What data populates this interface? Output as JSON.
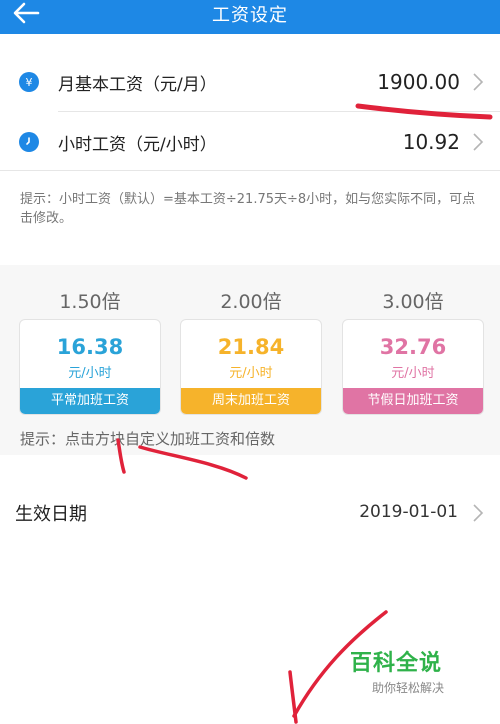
{
  "header": {
    "title": "工资设定"
  },
  "rows": {
    "monthly": {
      "label": "月基本工资（元/月）",
      "value": "1900.00",
      "icon": "¥"
    },
    "hourly": {
      "label": "小时工资（元/小时）",
      "value": "10.92",
      "icon": "clock-icon"
    }
  },
  "hint1": "提示：小时工资（默认）=基本工资÷21.75天÷8小时，如与您实际不同，可点击修改。",
  "overtime": [
    {
      "multiplier": "1.50倍",
      "rate": "16.38",
      "unit": "元/小时",
      "name": "平常加班工资",
      "color": "#2aa3d8"
    },
    {
      "multiplier": "2.00倍",
      "rate": "21.84",
      "unit": "元/小时",
      "name": "周末加班工资",
      "color": "#f6b32b"
    },
    {
      "multiplier": "3.00倍",
      "rate": "32.76",
      "unit": "元/小时",
      "name": "节假日加班工资",
      "color": "#e074a4"
    }
  ],
  "hint2": "提示：点击方块自定义加班工资和倍数",
  "effective": {
    "label": "生效日期",
    "value": "2019-01-01"
  },
  "watermark": {
    "title": "百科全说",
    "subtitle": "助你轻松解决"
  },
  "colors": {
    "brand": "#1e88e5",
    "annotation": "#e0223a"
  }
}
